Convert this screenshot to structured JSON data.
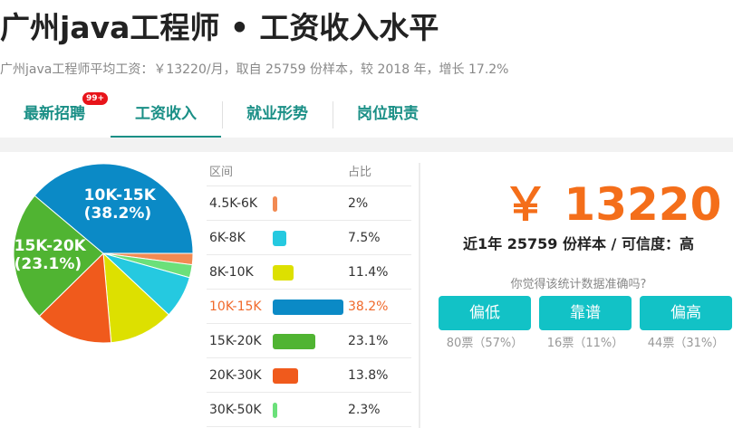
{
  "header": {
    "title": "广州java工程师 • 工资收入水平",
    "subtitle": "广州java工程师平均工资：￥13220/月，取自 25759 份样本，较 2018 年，增长 17.2%"
  },
  "tabs": [
    {
      "label": "最新招聘",
      "badge": "99+",
      "active": false
    },
    {
      "label": "工资收入",
      "active": true
    },
    {
      "label": "就业形势",
      "active": false
    },
    {
      "label": "岗位职责",
      "active": false
    }
  ],
  "table": {
    "col_range": "区间",
    "col_pct": "占比"
  },
  "chart_data": {
    "type": "pie",
    "categories": [
      "4.5K-6K",
      "6K-8K",
      "8K-10K",
      "10K-15K",
      "15K-20K",
      "20K-30K",
      "30K-50K"
    ],
    "values": [
      2,
      7.5,
      11.4,
      38.2,
      23.1,
      13.8,
      2.3
    ],
    "value_labels": [
      "2%",
      "7.5%",
      "11.4%",
      "38.2%",
      "23.1%",
      "13.8%",
      "2.3%"
    ],
    "colors": [
      "#f28a52",
      "#25c9e0",
      "#dde000",
      "#0b8ac6",
      "#50b432",
      "#f05a1c",
      "#6be07a"
    ],
    "highlight_index": 3,
    "slice_labels": [
      {
        "index": 3,
        "line1": "10K-15K",
        "line2": "(38.2%)"
      },
      {
        "index": 4,
        "line1": "15K-20K",
        "line2": "(23.1%)"
      }
    ]
  },
  "salary": {
    "price": "￥ 13220",
    "sample_text": "近1年 25759 份样本 / 可信度：高",
    "question": "你觉得该统计数据准确吗?",
    "votes": [
      {
        "label": "偏低",
        "result": "80票（57%）"
      },
      {
        "label": "靠谱",
        "result": "16票（11%）"
      },
      {
        "label": "偏高",
        "result": "44票（31%）"
      }
    ]
  },
  "colors": {
    "accent": "#1a8f86",
    "price": "#f46e1a",
    "button": "#12c2c6",
    "badge": "#e8141a"
  }
}
